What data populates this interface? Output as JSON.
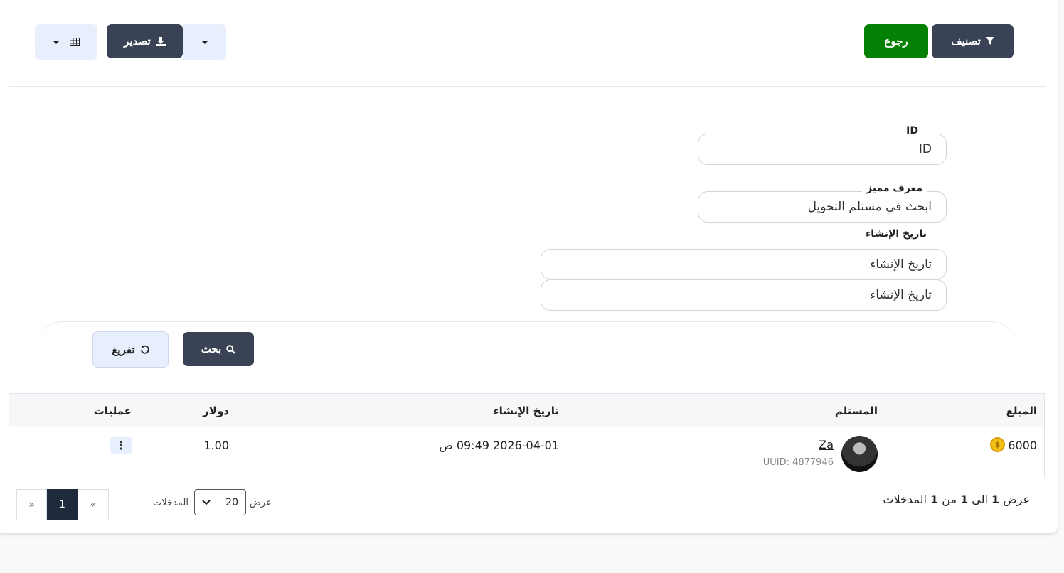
{
  "toolbar": {
    "filter_label": "تصنيف",
    "back_label": "رجوع",
    "export_label": "تصدير"
  },
  "form": {
    "id_legend": "ID",
    "id_placeholder": "ID",
    "uuid_legend": "معرف مميز",
    "uuid_placeholder": "ابحث في مستلم التحويل",
    "created_label": "تاريخ الإنشاء",
    "created_from_placeholder": "تاريخ الإنشاء",
    "created_to_placeholder": "تاريخ الإنشاء",
    "search_label": "بحث",
    "reset_label": "تفريغ"
  },
  "table": {
    "headers": {
      "amount": "المبلغ",
      "recipient": "المستلم",
      "created": "تاريخ الإنشاء",
      "dollar": "دولار",
      "actions": "عمليات"
    },
    "rows": [
      {
        "amount": "6000",
        "recipient_name": "Za",
        "recipient_uuid": "UUID: 4877946",
        "created": "2026-04-01 09:49 ص",
        "dollar": "1.00"
      }
    ]
  },
  "pagination": {
    "prev": "«",
    "current": "1",
    "next": "»",
    "per_page": "20",
    "show_label": "عرض",
    "entries_label": "المدخلات",
    "info_prefix": "عرض",
    "info_from": "1",
    "info_to_word": "الى",
    "info_to": "1",
    "info_of_word": "من",
    "info_total": "1",
    "info_suffix": "المدخلات"
  },
  "icons": {
    "filter": "filter-icon",
    "download": "download-icon",
    "table": "table-icon",
    "search": "search-icon",
    "reset": "undo-icon",
    "coin": "coin-icon",
    "more": "vertical-dots-icon"
  },
  "colors": {
    "primary_dark": "#3a4255",
    "success": "#048104",
    "light_button": "#e8effc",
    "active_page": "#1f2a3d"
  }
}
